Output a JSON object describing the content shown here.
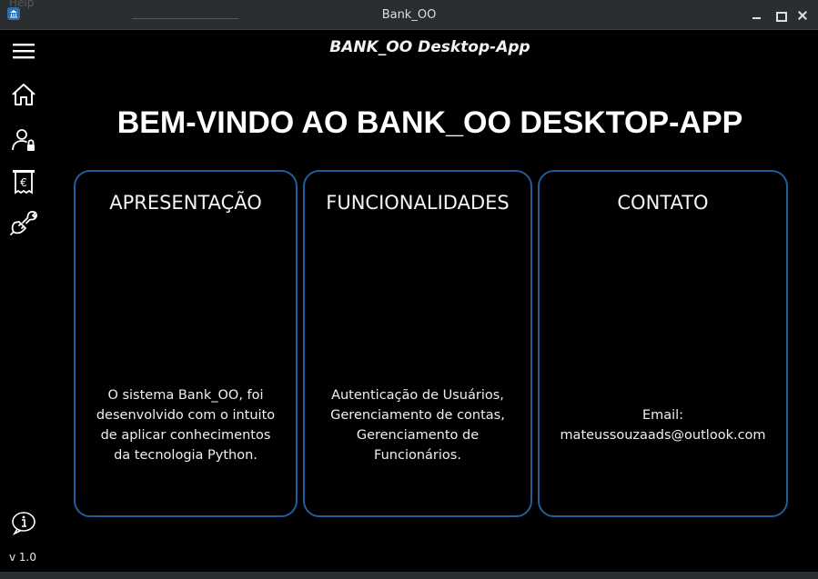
{
  "window": {
    "title": "Bank_OO",
    "ghost_help": "Help",
    "controls": {
      "minimize": "minimize",
      "maximize": "maximize",
      "close": "close"
    }
  },
  "sidebar": {
    "items": [
      {
        "icon": "hamburger-menu-icon"
      },
      {
        "icon": "home-icon"
      },
      {
        "icon": "user-lock-icon"
      },
      {
        "icon": "euro-receipt-icon"
      },
      {
        "icon": "wrench-plug-icon"
      }
    ],
    "info_icon": "info-icon",
    "version": "v 1.0"
  },
  "header": {
    "title": "BANK_OO Desktop-App"
  },
  "main": {
    "heading": "BEM-VINDO AO BANK_OO DESKTOP-APP",
    "cards": [
      {
        "title": "APRESENTAÇÃO",
        "lines": [
          "O sistema Bank_OO, foi",
          "desenvolvido com o intuito",
          "de aplicar conhecimentos",
          "da tecnologia Python."
        ]
      },
      {
        "title": "FUNCIONALIDADES",
        "lines": [
          "Autenticação de Usuários,",
          "Gerenciamento de contas,",
          "Gerenciamento de",
          "Funcionários."
        ]
      },
      {
        "title": "CONTATO",
        "lines": [
          "Email:",
          "mateussouzaads@outlook.com"
        ]
      }
    ]
  },
  "colors": {
    "background": "#000000",
    "card_border": "#1f5d9c",
    "titlebar": "#2b2e31"
  }
}
